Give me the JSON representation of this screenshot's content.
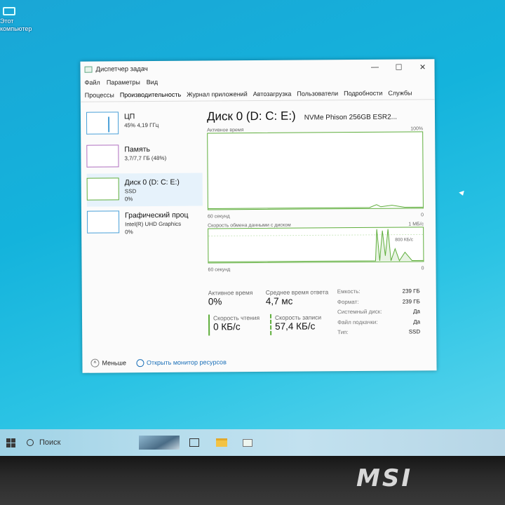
{
  "desktop": {
    "icon_label_1": "Этот",
    "icon_label_2": "компьютер"
  },
  "window": {
    "title": "Диспетчер задач",
    "controls": [
      "—",
      "☐",
      "✕"
    ],
    "menu": [
      "Файл",
      "Параметры",
      "Вид"
    ],
    "tabs": [
      "Процессы",
      "Производительность",
      "Журнал приложений",
      "Автозагрузка",
      "Пользователи",
      "Подробности",
      "Службы"
    ]
  },
  "sidebar": [
    {
      "name": "ЦП",
      "line1": "45% 4,19 ГГц",
      "line2": ""
    },
    {
      "name": "Память",
      "line1": "3,7/7,7 ГБ (48%)",
      "line2": ""
    },
    {
      "name": "Диск 0 (D: C: E:)",
      "line1": "SSD",
      "line2": "0%"
    },
    {
      "name": "Графический проц",
      "line1": "Intel(R) UHD Graphics",
      "line2": "0%"
    }
  ],
  "main": {
    "title": "Диск 0 (D: C: E:)",
    "model": "NVMe Phison 256GB ESR2...",
    "graph1": {
      "label_left": "Активное время",
      "label_right": "100%",
      "foot_left": "60 секунд",
      "foot_right": "0"
    },
    "graph2": {
      "label_left": "Скорость обмена данными с диском",
      "label_right": "1 МБ/с",
      "inner_label": "800 КБ/с",
      "foot_left": "60 секунд",
      "foot_right": "0"
    }
  },
  "stats": {
    "active_label": "Активное время",
    "active_value": "0%",
    "response_label": "Среднее время ответа",
    "response_value": "4,7 мс",
    "read_label": "Скорость чтения",
    "read_value": "0 КБ/с",
    "write_label": "Скорость записи",
    "write_value": "57,4 КБ/с",
    "props": [
      {
        "k": "Емкость:",
        "v": "239 ГБ"
      },
      {
        "k": "Формат:",
        "v": "239 ГБ"
      },
      {
        "k": "Системный диск:",
        "v": "Да"
      },
      {
        "k": "Файл подкачки:",
        "v": "Да"
      },
      {
        "k": "Тип:",
        "v": "SSD"
      }
    ]
  },
  "footer": {
    "less": "Меньше",
    "monitor": "Открыть монитор ресурсов"
  },
  "taskbar": {
    "search": "Поиск"
  },
  "brand": "MSI"
}
